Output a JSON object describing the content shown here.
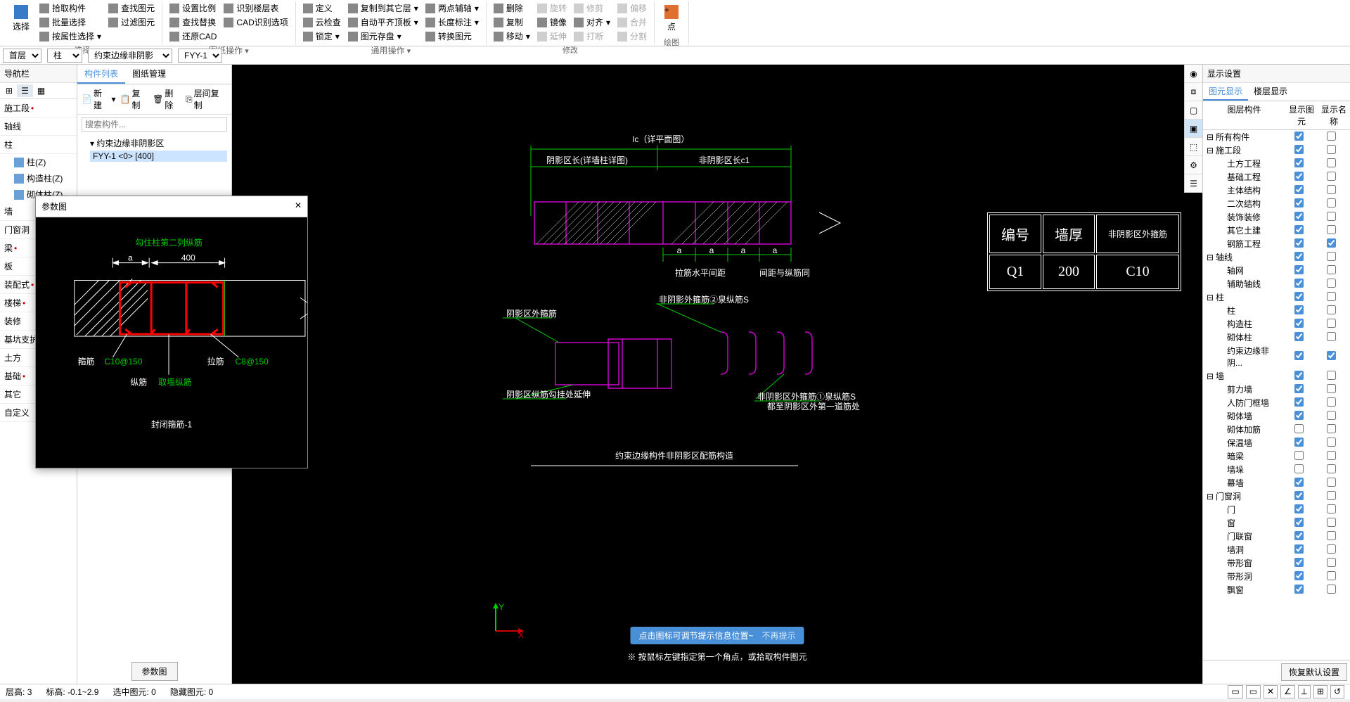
{
  "ribbon": {
    "select_group": "选择",
    "select": "选择",
    "pick_component": "拾取构件",
    "batch_select": "批量选择",
    "select_by_attr": "按属性选择",
    "find_elem": "查找图元",
    "filter_elem": "过滤图元",
    "drawing_ops": "图纸操作",
    "set_scale": "设置比例",
    "find_replace": "查找替换",
    "restore_cad": "还原CAD",
    "identify_layer": "识别楼层表",
    "cad_option": "CAD识别选项",
    "general_ops": "通用操作",
    "define": "定义",
    "cloud_check": "云检查",
    "lock": "锁定",
    "copy_other_layer": "复制到其它层",
    "auto_level": "自动平齐顶板",
    "elem_save": "图元存盘",
    "two_point_aux": "两点辅轴",
    "length_label": "长度标注",
    "convert_elem": "转换图元",
    "modify": "修改",
    "delete": "删除",
    "copy": "复制",
    "move": "移动",
    "rotate": "旋转",
    "mirror": "镜像",
    "extend": "延伸",
    "trim": "修剪",
    "align": "对齐",
    "break": "打断",
    "offset": "偏移",
    "merge": "合并",
    "split": "分割",
    "draw": "绘图",
    "point": "点"
  },
  "selectors": {
    "floor": "首层",
    "category": "柱",
    "subcat": "约束边缘非阴影",
    "item": "FYY-1"
  },
  "nav": {
    "title": "导航栏",
    "sections": [
      {
        "label": "施工段",
        "dot": true
      },
      {
        "label": "轴线"
      },
      {
        "label": "柱"
      }
    ],
    "column_items": [
      "柱(Z)",
      "构造柱(Z)",
      "砌体柱(Z)"
    ],
    "rest": [
      {
        "label": "墙"
      },
      {
        "label": "门窗洞"
      },
      {
        "label": "梁",
        "dot": true
      },
      {
        "label": "板"
      },
      {
        "label": "装配式",
        "dot": true
      },
      {
        "label": "楼梯",
        "dot": true
      },
      {
        "label": "装修"
      },
      {
        "label": "基坑支护"
      },
      {
        "label": "土方"
      },
      {
        "label": "基础",
        "dot": true
      },
      {
        "label": "其它"
      },
      {
        "label": "自定义"
      }
    ]
  },
  "comp": {
    "tab_list": "构件列表",
    "tab_drawing": "图纸管理",
    "new": "新建",
    "copy": "复制",
    "delete": "删除",
    "layer_copy": "层间复制",
    "search_placeholder": "搜索构件...",
    "tree_root": "约束边缘非阴影区",
    "tree_leaf": "FYY-1 <0> [400]",
    "param_btn": "参数图"
  },
  "param_popup": {
    "title": "参数图",
    "top_text": "勾住柱第二列纵筋",
    "dim_a": "a",
    "dim_400": "400",
    "gujin_label": "箍筋",
    "gujin_val": "C10@150",
    "lajin_label": "拉筋",
    "lajin_val": "C8@150",
    "zongjin_label": "纵筋",
    "zongjin_val": "取墙纵筋",
    "bottom": "封闭箍筋-1"
  },
  "canvas": {
    "title_lc": "lc（详平面图）",
    "zone1": "阴影区长(详墙柱详图)",
    "zone2": "非阴影区长c1",
    "table_h1": "编号",
    "table_h2": "墙厚",
    "table_h3": "非阴影区外箍筋",
    "q1": "Q1",
    "t200": "200",
    "c10": "C10",
    "bottom_title": "约束边缘构件非阴影区配筋构造",
    "prompt": "点击图标可调节提示信息位置~",
    "no_prompt": "不再提示",
    "cmd": "※ 按鼠标左键指定第一个角点，或拾取构件图元",
    "dim_a": "a",
    "label_spacing": "拉筋水平间距",
    "label_same": "间距与纵筋同",
    "label_left_small": "墙厚",
    "note2_prefix": "②",
    "note2_text": "非阴影外箍筋②泉纵筋S",
    "note_left1": "阴影区外箍筋",
    "note_left2": "阴影区纵筋勾挂处延伸",
    "note1_prefix": "①",
    "note1_text": "非阴影区外箍筋①泉纵筋S",
    "note1_sub": "都至阴影区外第一道筋处"
  },
  "rp": {
    "title": "显示设置",
    "tab1": "图元显示",
    "tab2": "楼层显示",
    "col1": "图层构件",
    "col2": "显示图元",
    "col3": "显示名称",
    "items": [
      {
        "label": "所有构件",
        "group": true,
        "c1": true,
        "c2": false
      },
      {
        "label": "施工段",
        "group": true,
        "c1": true,
        "c2": false
      },
      {
        "label": "土方工程",
        "child": true,
        "c1": true,
        "c2": false
      },
      {
        "label": "基础工程",
        "child": true,
        "c1": true,
        "c2": false
      },
      {
        "label": "主体结构",
        "child": true,
        "c1": true,
        "c2": false
      },
      {
        "label": "二次结构",
        "child": true,
        "c1": true,
        "c2": false
      },
      {
        "label": "装饰装修",
        "child": true,
        "c1": true,
        "c2": false
      },
      {
        "label": "其它土建",
        "child": true,
        "c1": true,
        "c2": false
      },
      {
        "label": "钢筋工程",
        "child": true,
        "c1": true,
        "c2": true
      },
      {
        "label": "轴线",
        "group": true,
        "c1": true,
        "c2": false
      },
      {
        "label": "轴网",
        "child": true,
        "c1": true,
        "c2": false
      },
      {
        "label": "辅助轴线",
        "child": true,
        "c1": true,
        "c2": false
      },
      {
        "label": "柱",
        "group": true,
        "c1": true,
        "c2": false
      },
      {
        "label": "柱",
        "child": true,
        "c1": true,
        "c2": false
      },
      {
        "label": "构造柱",
        "child": true,
        "c1": true,
        "c2": false
      },
      {
        "label": "砌体柱",
        "child": true,
        "c1": true,
        "c2": false
      },
      {
        "label": "约束边缘非阴...",
        "child": true,
        "c1": true,
        "c2": true
      },
      {
        "label": "墙",
        "group": true,
        "c1": true,
        "c2": false
      },
      {
        "label": "剪力墙",
        "child": true,
        "c1": true,
        "c2": false
      },
      {
        "label": "人防门框墙",
        "child": true,
        "c1": true,
        "c2": false
      },
      {
        "label": "砌体墙",
        "child": true,
        "c1": true,
        "c2": false
      },
      {
        "label": "砌体加筋",
        "child": true,
        "c1": false,
        "c2": false
      },
      {
        "label": "保温墙",
        "child": true,
        "c1": true,
        "c2": false
      },
      {
        "label": "暗梁",
        "child": true,
        "c1": false,
        "c2": false
      },
      {
        "label": "墙垛",
        "child": true,
        "c1": false,
        "c2": false
      },
      {
        "label": "幕墙",
        "child": true,
        "c1": true,
        "c2": false
      },
      {
        "label": "门窗洞",
        "group": true,
        "c1": true,
        "c2": false
      },
      {
        "label": "门",
        "child": true,
        "c1": true,
        "c2": false
      },
      {
        "label": "窗",
        "child": true,
        "c1": true,
        "c2": false
      },
      {
        "label": "门联窗",
        "child": true,
        "c1": true,
        "c2": false
      },
      {
        "label": "墙洞",
        "child": true,
        "c1": true,
        "c2": false
      },
      {
        "label": "带形窗",
        "child": true,
        "c1": true,
        "c2": false
      },
      {
        "label": "带形洞",
        "child": true,
        "c1": true,
        "c2": false
      },
      {
        "label": "飘窗",
        "child": true,
        "c1": true,
        "c2": false
      }
    ],
    "restore": "恢复默认设置"
  },
  "status": {
    "floor": "层高:",
    "floor_v": "3",
    "elev": "标高:",
    "elev_v": "-0.1~2.9",
    "sel": "选中图元:",
    "sel_v": "0",
    "hid": "隐藏图元:",
    "hid_v": "0"
  }
}
